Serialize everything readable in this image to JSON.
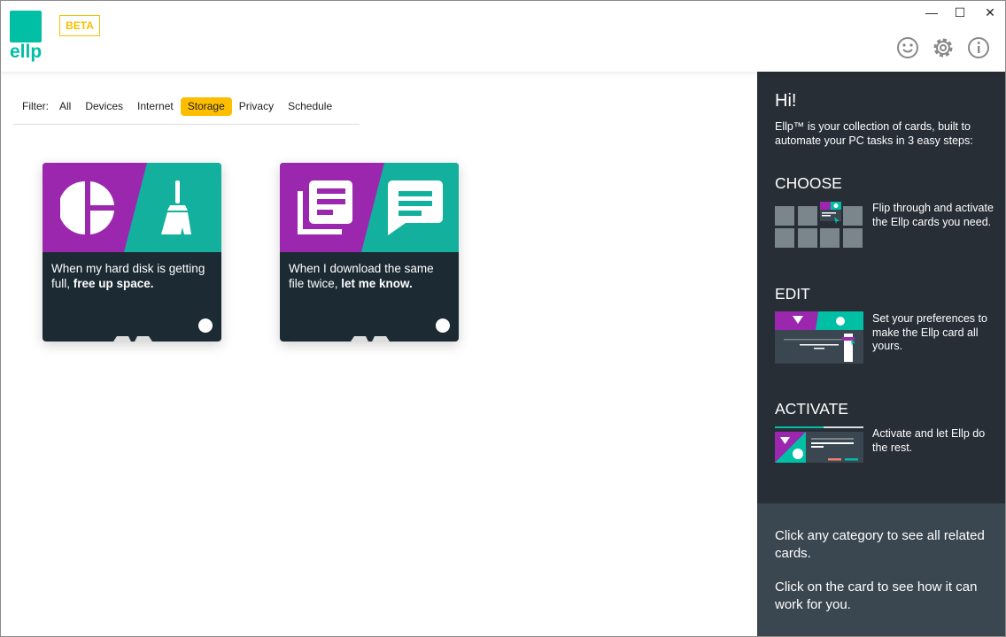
{
  "app": {
    "logo_text": "ellp",
    "beta_label": "BETA"
  },
  "window_controls": {
    "minimize": "—",
    "maximize": "☐",
    "close": "✕"
  },
  "header_icons": [
    "smiley-icon",
    "gear-icon",
    "info-icon"
  ],
  "filter": {
    "label": "Filter:",
    "items": [
      "All",
      "Devices",
      "Internet",
      "Storage",
      "Privacy",
      "Schedule"
    ],
    "active": "Storage"
  },
  "cards": [
    {
      "text": "When my hard disk is getting full, ",
      "bold": "free up space.",
      "left_icon": "pie-chart-icon",
      "right_icon": "broom-icon"
    },
    {
      "text": "When I download the same file twice, ",
      "bold": "let me know.",
      "left_icon": "documents-icon",
      "right_icon": "message-icon"
    }
  ],
  "sidebar": {
    "greeting": "Hi!",
    "intro": "Ellp™ is your collection of cards, built to automate your PC tasks in 3 easy steps:",
    "steps": [
      {
        "title": "CHOOSE",
        "desc": "Flip through and activate the Ellp cards you need."
      },
      {
        "title": "EDIT",
        "desc": "Set your preferences to make the Ellp card all yours."
      },
      {
        "title": "ACTIVATE",
        "desc": "Activate and let Ellp do the rest."
      }
    ],
    "tips": [
      "Click any category to see all related cards.",
      "Click on the card to see how it can work for you."
    ]
  },
  "colors": {
    "brand": "#00bfa5",
    "purple": "#9b27af",
    "accent": "#fdbe00",
    "sidebar": "#272e36"
  }
}
